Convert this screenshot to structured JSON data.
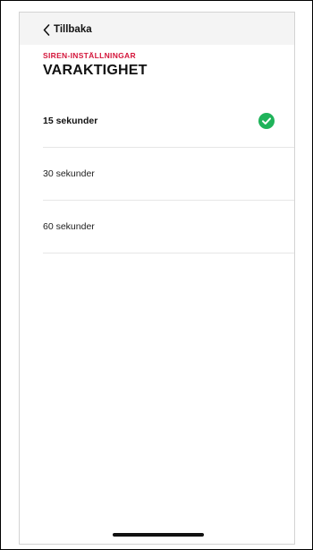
{
  "nav": {
    "back_label": "Tillbaka"
  },
  "header": {
    "eyebrow": "SIREN-INSTÄLLNINGAR",
    "title": "VARAKTIGHET"
  },
  "options": [
    {
      "label": "15 sekunder",
      "selected": true
    },
    {
      "label": "30 sekunder",
      "selected": false
    },
    {
      "label": "60 sekunder",
      "selected": false
    }
  ],
  "colors": {
    "accent_red": "#d4163b",
    "check_green": "#1fb35a",
    "topbar_bg": "#f4f4f4"
  },
  "icons": {
    "back": "chevron-left-icon",
    "selected": "check-circle-icon"
  }
}
